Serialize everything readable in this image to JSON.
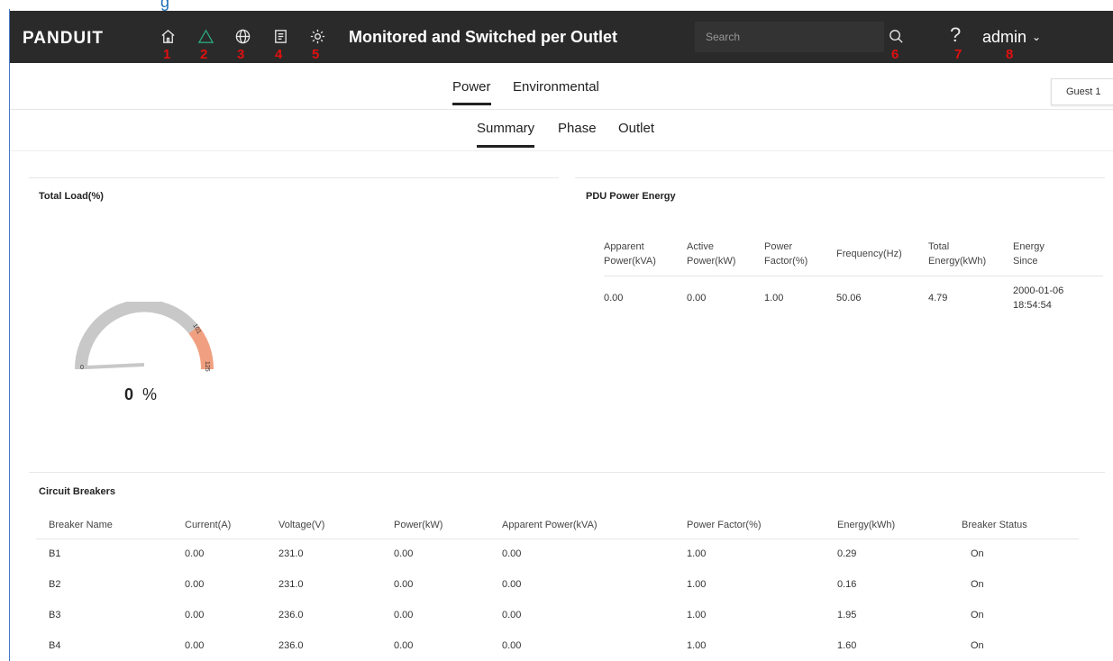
{
  "top_fragment": "g",
  "brand": {
    "logo": "PANDUIT"
  },
  "nav": {
    "icons": [
      {
        "name": "home-icon",
        "number": "1"
      },
      {
        "name": "alarm-icon",
        "number": "2"
      },
      {
        "name": "globe-icon",
        "number": "3"
      },
      {
        "name": "log-icon",
        "number": "4"
      },
      {
        "name": "settings-icon",
        "number": "5"
      }
    ],
    "title": "Monitored and Switched per Outlet",
    "search_placeholder": "Search",
    "search_number": "6",
    "help_glyph": "?",
    "help_number": "7",
    "user": "admin",
    "user_number": "8"
  },
  "tabs": {
    "power": "Power",
    "environmental": "Environmental",
    "guest": "Guest 1"
  },
  "subtabs": {
    "summary": "Summary",
    "phase": "Phase",
    "outlet": "Outlet"
  },
  "total_load": {
    "title": "Total Load(%)",
    "value": "0",
    "unit": "%",
    "min_label": "0",
    "warn_label": "101",
    "max_label": "125",
    "warning_color": "#f0a080",
    "track_color": "#c8c8c8"
  },
  "pdu_energy": {
    "title": "PDU Power Energy",
    "headers": [
      [
        "Apparent",
        "Power(kVA)"
      ],
      [
        "Active",
        "Power(kW)"
      ],
      [
        "Power",
        "Factor(%)"
      ],
      [
        "Frequency(Hz)",
        ""
      ],
      [
        "Total",
        "Energy(kWh)"
      ],
      [
        "Energy",
        "Since"
      ]
    ],
    "values": [
      "0.00",
      "0.00",
      "1.00",
      "50.06",
      "4.79",
      [
        "2000-01-06",
        "18:54:54"
      ]
    ]
  },
  "circuit_breakers": {
    "title": "Circuit Breakers",
    "headers": [
      "Breaker Name",
      "Current(A)",
      "Voltage(V)",
      "Power(kW)",
      "Apparent Power(kVA)",
      "Power Factor(%)",
      "Energy(kWh)",
      "Breaker Status"
    ],
    "rows": [
      [
        "B1",
        "0.00",
        "231.0",
        "0.00",
        "0.00",
        "1.00",
        "0.29",
        "On"
      ],
      [
        "B2",
        "0.00",
        "231.0",
        "0.00",
        "0.00",
        "1.00",
        "0.16",
        "On"
      ],
      [
        "B3",
        "0.00",
        "236.0",
        "0.00",
        "0.00",
        "1.00",
        "1.95",
        "On"
      ],
      [
        "B4",
        "0.00",
        "236.0",
        "0.00",
        "0.00",
        "1.00",
        "1.60",
        "On"
      ]
    ]
  }
}
